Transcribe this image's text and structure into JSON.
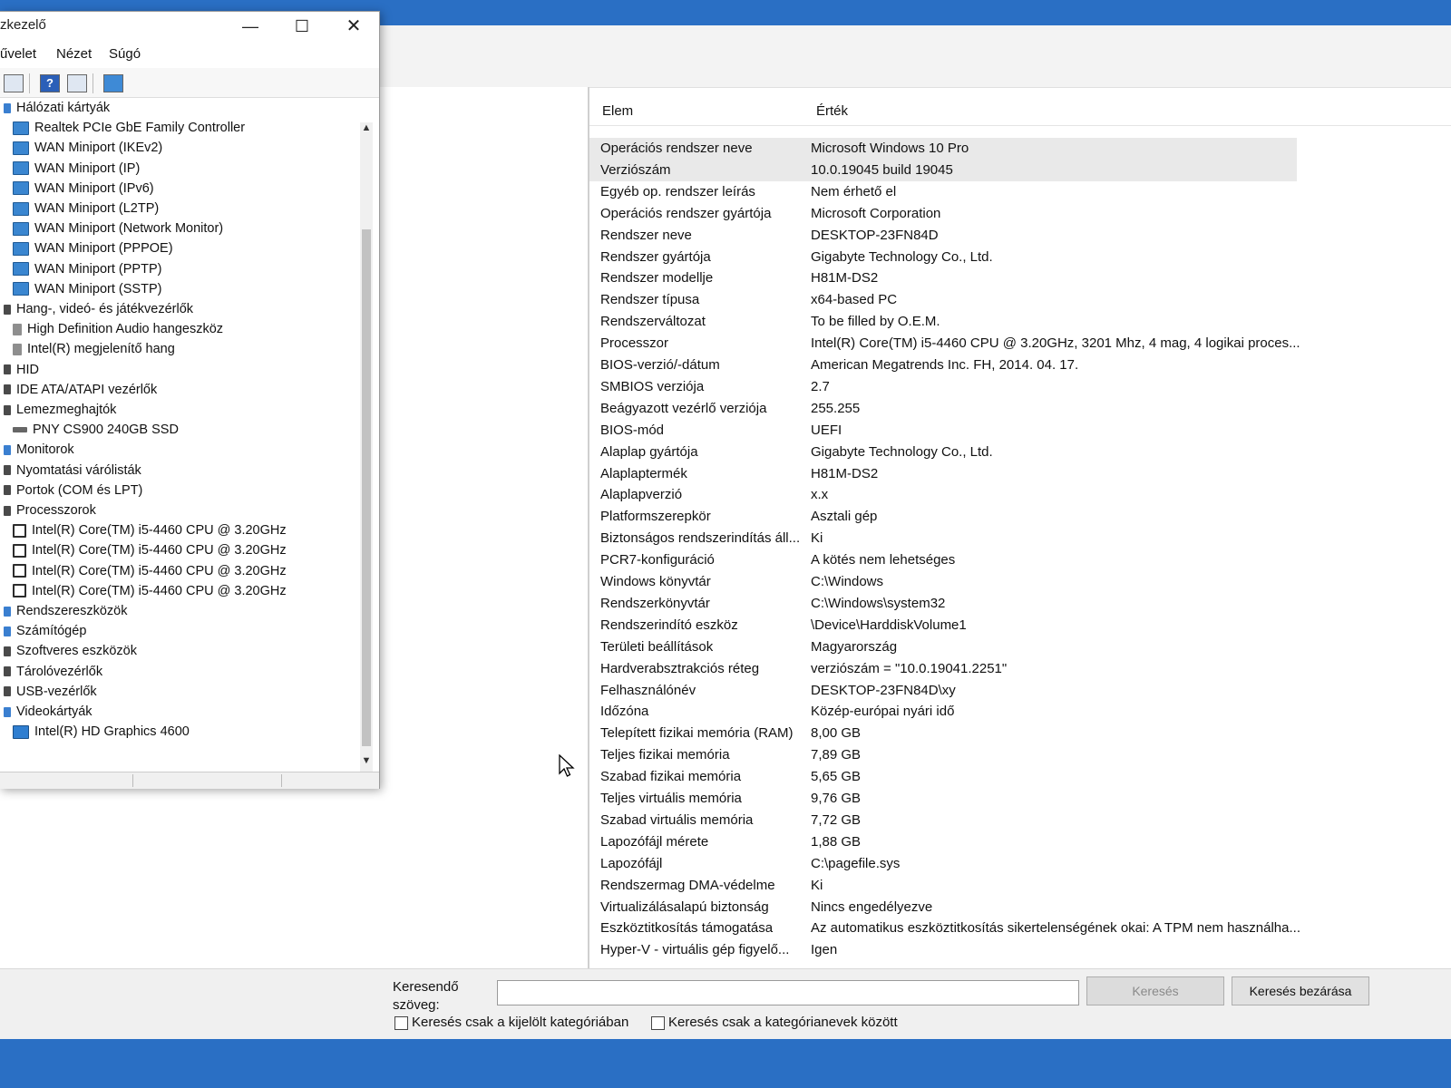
{
  "sysinfo": {
    "columns": {
      "elem": "Elem",
      "value": "Érték"
    },
    "rows": [
      {
        "k": "Operációs rendszer neve",
        "v": "Microsoft Windows 10 Pro"
      },
      {
        "k": "Verziószám",
        "v": "10.0.19045 build 19045"
      },
      {
        "k": "Egyéb op. rendszer leírás",
        "v": "Nem érhető el"
      },
      {
        "k": "Operációs rendszer gyártója",
        "v": "Microsoft Corporation"
      },
      {
        "k": "Rendszer neve",
        "v": "DESKTOP-23FN84D"
      },
      {
        "k": "Rendszer gyártója",
        "v": "Gigabyte Technology Co., Ltd."
      },
      {
        "k": "Rendszer modellje",
        "v": "H81M-DS2"
      },
      {
        "k": "Rendszer típusa",
        "v": "x64-based PC"
      },
      {
        "k": "Rendszerváltozat",
        "v": "To be filled by O.E.M."
      },
      {
        "k": "Processzor",
        "v": "Intel(R) Core(TM) i5-4460  CPU @ 3.20GHz, 3201 Mhz, 4 mag, 4 logikai proces..."
      },
      {
        "k": "BIOS-verzió/-dátum",
        "v": "American Megatrends Inc. FH, 2014. 04. 17."
      },
      {
        "k": "SMBIOS verziója",
        "v": "2.7"
      },
      {
        "k": "Beágyazott vezérlő verziója",
        "v": "255.255"
      },
      {
        "k": "BIOS-mód",
        "v": "UEFI"
      },
      {
        "k": "Alaplap gyártója",
        "v": "Gigabyte Technology Co., Ltd."
      },
      {
        "k": "Alaplaptermék",
        "v": "H81M-DS2"
      },
      {
        "k": "Alaplapverzió",
        "v": "x.x"
      },
      {
        "k": "Platformszerepkör",
        "v": "Asztali gép"
      },
      {
        "k": "Biztonságos rendszerindítás áll...",
        "v": "Ki"
      },
      {
        "k": "PCR7-konfiguráció",
        "v": "A kötés nem lehetséges"
      },
      {
        "k": "Windows könyvtár",
        "v": "C:\\Windows"
      },
      {
        "k": "Rendszerkönyvtár",
        "v": "C:\\Windows\\system32"
      },
      {
        "k": "Rendszerindító eszköz",
        "v": "\\Device\\HarddiskVolume1"
      },
      {
        "k": "Területi beállítások",
        "v": "Magyarország"
      },
      {
        "k": "Hardverabsztrakciós réteg",
        "v": "verziószám = \"10.0.19041.2251\""
      },
      {
        "k": "Felhasználónév",
        "v": "DESKTOP-23FN84D\\xy"
      },
      {
        "k": "Időzóna",
        "v": "Közép-európai nyári idő"
      },
      {
        "k": "Telepített fizikai memória (RAM)",
        "v": "8,00 GB"
      },
      {
        "k": "Teljes fizikai memória",
        "v": "7,89 GB"
      },
      {
        "k": "Szabad fizikai memória",
        "v": "5,65 GB"
      },
      {
        "k": "Teljes virtuális memória",
        "v": "9,76 GB"
      },
      {
        "k": "Szabad virtuális memória",
        "v": "7,72 GB"
      },
      {
        "k": "Lapozófájl mérete",
        "v": "1,88 GB"
      },
      {
        "k": "Lapozófájl",
        "v": "C:\\pagefile.sys"
      },
      {
        "k": "Rendszermag DMA-védelme",
        "v": "Ki"
      },
      {
        "k": "Virtualizálásalapú biztonság",
        "v": "Nincs engedélyezve"
      },
      {
        "k": "Eszköztitkosítás támogatása",
        "v": "Az automatikus eszköztitkosítás sikertelenségének okai: A TPM nem használha..."
      },
      {
        "k": "Hyper-V - virtuális gép figyelő...",
        "v": "Igen"
      }
    ],
    "search": {
      "label": "Keresendő szöveg:",
      "search_button": "Keresés",
      "close_button": "Keresés bezárása",
      "chk_selected_category": "Keresés csak a kijelölt kategóriában",
      "chk_category_names": "Keresés csak a kategórianevek között"
    }
  },
  "devmgr": {
    "title": "zkezelő",
    "menu": {
      "action": "űvelet",
      "view": "Nézet",
      "help": "Súgó"
    },
    "tree": [
      {
        "t": "Hálózati kártyák",
        "lvl": 0,
        "icon": "catblue"
      },
      {
        "t": "Realtek PCIe GbE Family Controller",
        "lvl": 1,
        "icon": "net"
      },
      {
        "t": "WAN Miniport (IKEv2)",
        "lvl": 1,
        "icon": "net"
      },
      {
        "t": "WAN Miniport (IP)",
        "lvl": 1,
        "icon": "net"
      },
      {
        "t": "WAN Miniport (IPv6)",
        "lvl": 1,
        "icon": "net"
      },
      {
        "t": "WAN Miniport (L2TP)",
        "lvl": 1,
        "icon": "net"
      },
      {
        "t": "WAN Miniport (Network Monitor)",
        "lvl": 1,
        "icon": "net"
      },
      {
        "t": "WAN Miniport (PPPOE)",
        "lvl": 1,
        "icon": "net"
      },
      {
        "t": "WAN Miniport (PPTP)",
        "lvl": 1,
        "icon": "net"
      },
      {
        "t": "WAN Miniport (SSTP)",
        "lvl": 1,
        "icon": "net"
      },
      {
        "t": "Hang-, videó- és játékvezérlők",
        "lvl": 0,
        "icon": "cat"
      },
      {
        "t": "High Definition Audio hangeszköz",
        "lvl": 1,
        "icon": "snd"
      },
      {
        "t": "Intel(R) megjelenítő hang",
        "lvl": 1,
        "icon": "snd"
      },
      {
        "t": "HID",
        "lvl": 0,
        "icon": "cat"
      },
      {
        "t": "IDE ATA/ATAPI vezérlők",
        "lvl": 0,
        "icon": "cat"
      },
      {
        "t": "Lemezmeghajtók",
        "lvl": 0,
        "icon": "cat"
      },
      {
        "t": "PNY CS900 240GB SSD",
        "lvl": 1,
        "icon": "disk"
      },
      {
        "t": "Monitorok",
        "lvl": 0,
        "icon": "catblue"
      },
      {
        "t": "Nyomtatási várólisták",
        "lvl": 0,
        "icon": "cat"
      },
      {
        "t": "Portok (COM és LPT)",
        "lvl": 0,
        "icon": "cat"
      },
      {
        "t": "Processzorok",
        "lvl": 0,
        "icon": "cat"
      },
      {
        "t": "Intel(R) Core(TM) i5-4460  CPU @ 3.20GHz",
        "lvl": 1,
        "icon": "cpu"
      },
      {
        "t": "Intel(R) Core(TM) i5-4460  CPU @ 3.20GHz",
        "lvl": 1,
        "icon": "cpu"
      },
      {
        "t": "Intel(R) Core(TM) i5-4460  CPU @ 3.20GHz",
        "lvl": 1,
        "icon": "cpu"
      },
      {
        "t": "Intel(R) Core(TM) i5-4460  CPU @ 3.20GHz",
        "lvl": 1,
        "icon": "cpu"
      },
      {
        "t": "Rendszereszközök",
        "lvl": 0,
        "icon": "catblue"
      },
      {
        "t": "Számítógép",
        "lvl": 0,
        "icon": "catblue"
      },
      {
        "t": "Szoftveres eszközök",
        "lvl": 0,
        "icon": "cat"
      },
      {
        "t": "Tárolóvezérlők",
        "lvl": 0,
        "icon": "cat"
      },
      {
        "t": "USB-vezérlők",
        "lvl": 0,
        "icon": "cat"
      },
      {
        "t": "Videokártyák",
        "lvl": 0,
        "icon": "catblue"
      },
      {
        "t": "Intel(R) HD Graphics 4600",
        "lvl": 1,
        "icon": "gpu"
      }
    ]
  }
}
